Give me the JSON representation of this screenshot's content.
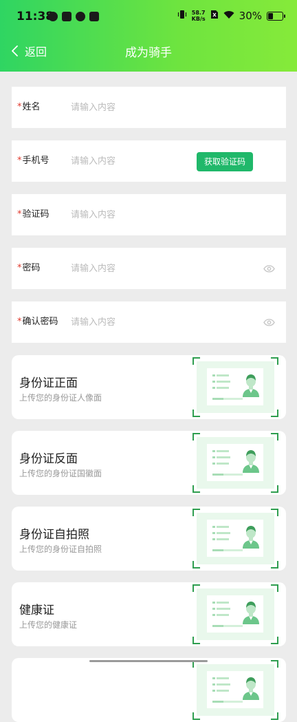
{
  "status_bar": {
    "time": "11:38",
    "net_speed_value": "58.7",
    "net_speed_unit": "KB/s",
    "battery_text": "30%",
    "battery_level": 0.3
  },
  "nav": {
    "back_label": "返回",
    "title": "成为骑手"
  },
  "form": {
    "name": {
      "label": "姓名",
      "placeholder": "请输入内容"
    },
    "phone": {
      "label": "手机号",
      "placeholder": "请输入内容",
      "code_button": "获取验证码"
    },
    "code": {
      "label": "验证码",
      "placeholder": "请输入内容"
    },
    "password": {
      "label": "密码",
      "placeholder": "请输入内容"
    },
    "confirm_password": {
      "label": "确认密码",
      "placeholder": "请输入内容"
    },
    "required_mark": "*"
  },
  "uploads": [
    {
      "title": "身份证正面",
      "subtitle": "上传您的身份证人像面"
    },
    {
      "title": "身份证反面",
      "subtitle": "上传您的身份证国徽面"
    },
    {
      "title": "身份证自拍照",
      "subtitle": "上传您的身份证自拍照"
    },
    {
      "title": "健康证",
      "subtitle": "上传您的健康证"
    }
  ],
  "colors": {
    "header_start": "#2fd562",
    "header_end": "#86ea3a",
    "accent_button": "#20b86a",
    "required": "#e0382b"
  },
  "icons": {
    "back": "chevron-left-icon",
    "password_toggle": "eye-icon",
    "id_placeholder": "id-card-icon"
  }
}
